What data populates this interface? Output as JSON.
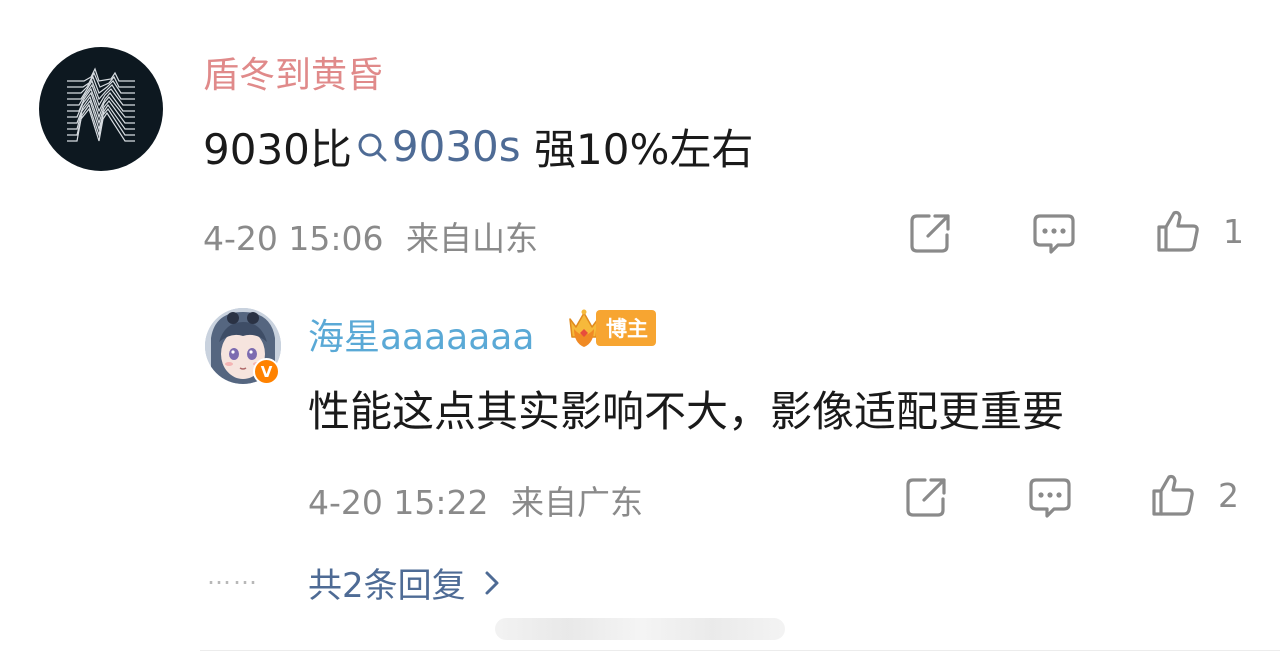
{
  "main_comment": {
    "username": "盾冬到黄昏",
    "text_before": "9030比",
    "topic": "9030s",
    "text_after": " 强10%左右",
    "time": "4-20 15:06",
    "location": "来自山东",
    "like_count": "1"
  },
  "reply": {
    "username": "海星aaaaaaa",
    "badge_label": "博主",
    "verified_mark": "V",
    "text": "性能这点其实影响不大，影像适配更重要",
    "time": "4-20 15:22",
    "location": "来自广东",
    "like_count": "2"
  },
  "more_replies": {
    "dots": "……",
    "label": "共2条回复"
  },
  "icons": [
    "share-icon",
    "comment-icon",
    "like-icon",
    "search-icon",
    "chevron-right-icon",
    "crown-icon"
  ],
  "colors": {
    "username_main": "#e08a8a",
    "username_reply": "#5aa9d6",
    "link": "#4e6b95",
    "meta": "#8a8a8a",
    "badge": "#f7a531",
    "verified": "#ff8200"
  }
}
